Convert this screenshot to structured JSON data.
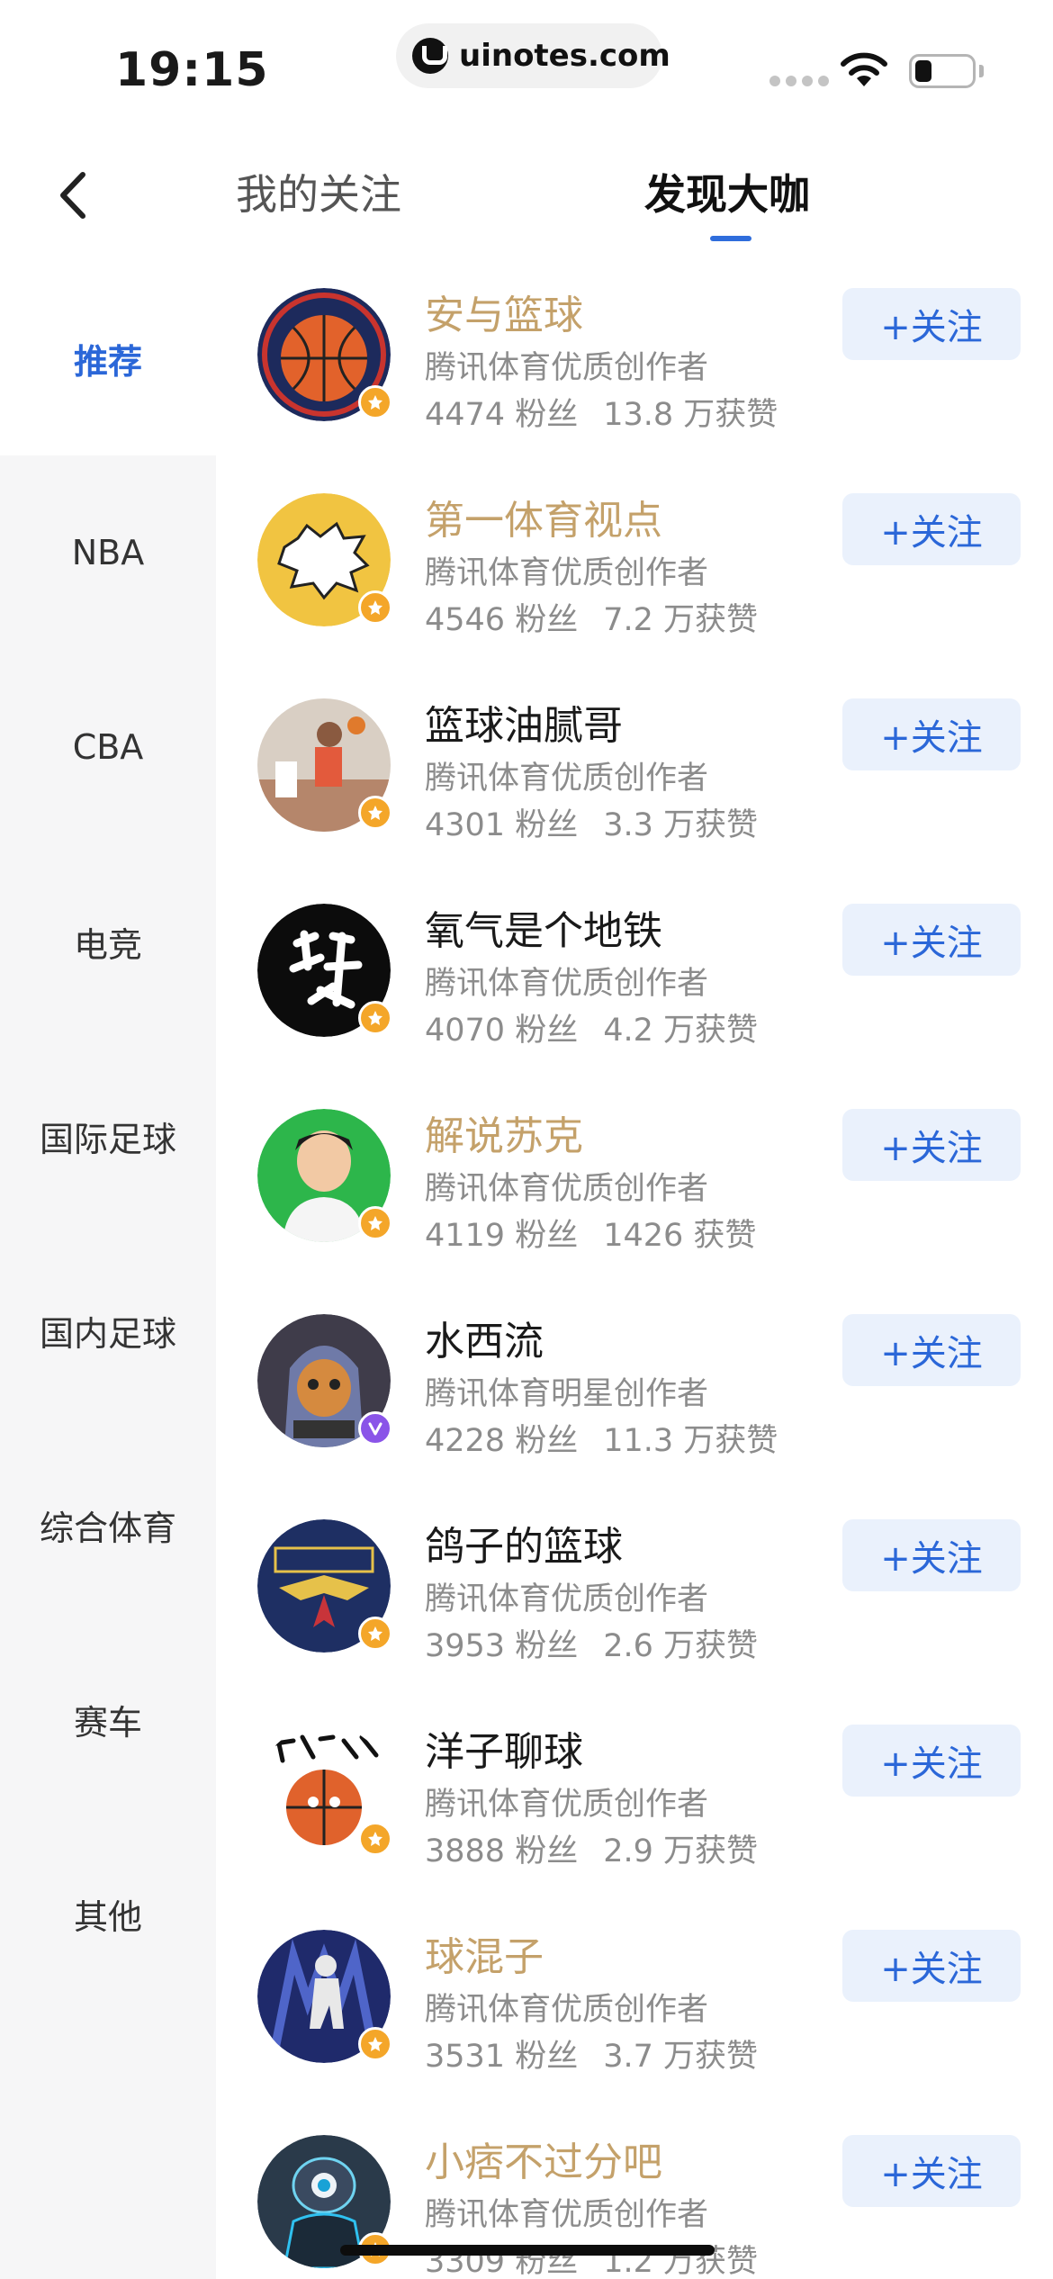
{
  "status_bar": {
    "time": "19:15",
    "url": "uinotes.com"
  },
  "header": {
    "back_icon": "chevron-left-icon",
    "tabs": [
      {
        "label": "我的关注",
        "active": false
      },
      {
        "label": "发现大咖",
        "active": true
      }
    ],
    "accent_color": "#2f6ddc"
  },
  "sidebar": {
    "items": [
      {
        "label": "推荐",
        "active": true
      },
      {
        "label": "NBA"
      },
      {
        "label": "CBA"
      },
      {
        "label": "电竞"
      },
      {
        "label": "国际足球"
      },
      {
        "label": "国内足球"
      },
      {
        "label": "综合体育"
      },
      {
        "label": "赛车"
      },
      {
        "label": "其他"
      }
    ]
  },
  "creators": [
    {
      "name": "安与篮球",
      "name_color": "gold",
      "desc": "腾讯体育优质创作者",
      "fans": "4474 粉丝",
      "likes": "13.8 万获赞",
      "badge": "gold",
      "follow_label": "+关注"
    },
    {
      "name": "第一体育视点",
      "name_color": "gold",
      "desc": "腾讯体育优质创作者",
      "fans": "4546 粉丝",
      "likes": "7.2 万获赞",
      "badge": "gold",
      "follow_label": "+关注"
    },
    {
      "name": "篮球油腻哥",
      "name_color": "normal",
      "desc": "腾讯体育优质创作者",
      "fans": "4301 粉丝",
      "likes": "3.3 万获赞",
      "badge": "gold",
      "follow_label": "+关注"
    },
    {
      "name": "氧气是个地铁",
      "name_color": "normal",
      "desc": "腾讯体育优质创作者",
      "fans": "4070 粉丝",
      "likes": "4.2 万获赞",
      "badge": "gold",
      "follow_label": "+关注"
    },
    {
      "name": "解说苏克",
      "name_color": "gold",
      "desc": "腾讯体育优质创作者",
      "fans": "4119 粉丝",
      "likes": "1426 获赞",
      "badge": "gold",
      "follow_label": "+关注"
    },
    {
      "name": "水西流",
      "name_color": "normal",
      "desc": "腾讯体育明星创作者",
      "fans": "4228 粉丝",
      "likes": "11.3 万获赞",
      "badge": "purple",
      "follow_label": "+关注"
    },
    {
      "name": "鸽子的篮球",
      "name_color": "normal",
      "desc": "腾讯体育优质创作者",
      "fans": "3953 粉丝",
      "likes": "2.6 万获赞",
      "badge": "gold",
      "follow_label": "+关注"
    },
    {
      "name": "洋子聊球",
      "name_color": "normal",
      "desc": "腾讯体育优质创作者",
      "fans": "3888 粉丝",
      "likes": "2.9 万获赞",
      "badge": "gold",
      "follow_label": "+关注"
    },
    {
      "name": "球混子",
      "name_color": "gold",
      "desc": "腾讯体育优质创作者",
      "fans": "3531 粉丝",
      "likes": "3.7 万获赞",
      "badge": "gold",
      "follow_label": "+关注"
    },
    {
      "name": "小痞不过分吧",
      "name_color": "gold",
      "desc": "腾讯体育优质创作者",
      "fans": "3309 粉丝",
      "likes": "1.2 万获赞",
      "badge": "gold",
      "follow_label": "+关注"
    }
  ],
  "colors": {
    "gold_name": "#c4a16a",
    "follow_text": "#2b67d8",
    "follow_bg": "#eaf1fc",
    "sidebar_bg": "#f6f6f7"
  }
}
